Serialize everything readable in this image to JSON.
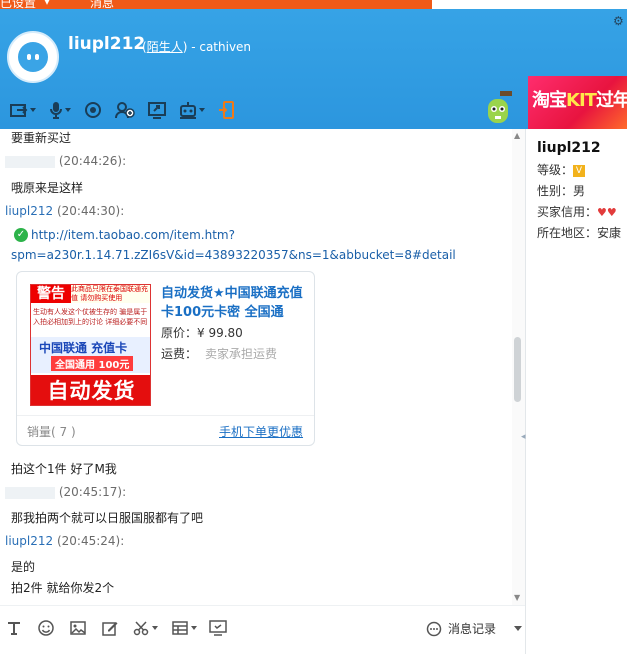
{
  "top": {
    "left_label": "已设置",
    "mid_label": "消息"
  },
  "header": {
    "name": "liupl212",
    "relation_open": "(",
    "relation_link": "陌生人",
    "relation_rest": ") - cathiven"
  },
  "ad": {
    "text_a": "淘宝",
    "text_b": "KIT",
    "text_c": "过年"
  },
  "chat": {
    "m0": "要重新买过",
    "m1_time": "(20:44:26):",
    "m1_text": "哦原来是这样",
    "m2_who": "liupl212",
    "m2_time": "(20:44:30):",
    "url_line1": "http://item.taobao.com/item.htm?",
    "url_line2": "spm=a230r.1.14.71.zZI6sV&id=43893220357&ns=1&abbucket=8#detail",
    "card": {
      "warn_label": "警告",
      "warn_line": "此商品只限在泰国联通充值 请勿购买使用",
      "notice_text": "生动有人发这个仗被生存的 骗是属于入拍必相加到上的讨论 详细必要不同",
      "img_l1": "中国联通 充值卡",
      "img_l2": "全国通用 100元",
      "img_auto": "自动发货",
      "title": "自动发货★中国联通充值卡100元卡密 全国通",
      "price_label": "原价：",
      "price_value": "¥ 99.80",
      "ship_label": "运费：",
      "ship_value": "卖家承担运费",
      "sales": "销量( 7 )",
      "mobile_link": "手机下单更优惠"
    },
    "m3_text": "拍这个1件 好了M我",
    "m4_time": "(20:45:17):",
    "m4_text": "那我拍两个就可以日服国服都有了吧",
    "m5_who": "liupl212",
    "m5_time": "(20:45:24):",
    "m5_text": "是的",
    "m6_text": "拍2件 就给你发2个"
  },
  "profile": {
    "name": "liupl212",
    "level_label": "等级：",
    "gender_label": "性别：",
    "gender_value": "男",
    "credit_label": "买家信用：",
    "region_label": "所在地区：",
    "region_value": "安康"
  },
  "input_bar": {
    "history_label": "消息记录"
  },
  "colors": {
    "header_blue": "#2c96de",
    "link_blue": "#1a5fa8",
    "orange": "#f05a18"
  }
}
